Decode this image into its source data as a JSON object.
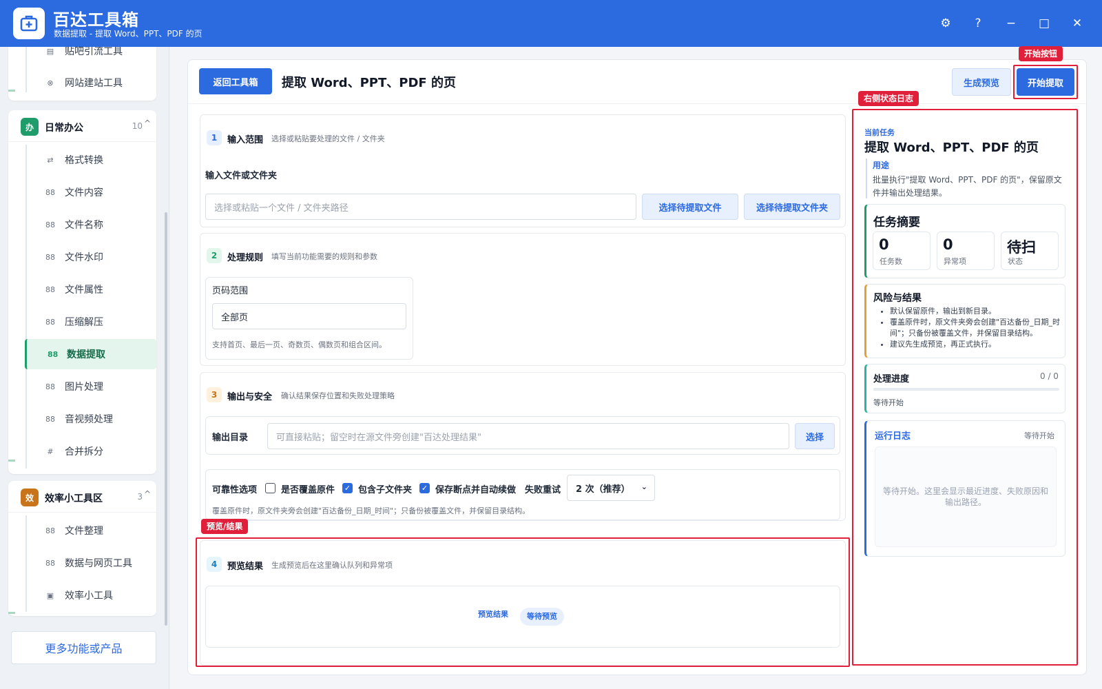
{
  "app": {
    "name": "百达工具箱",
    "subtitle": "数据提取 - 提取 Word、PPT、PDF 的页",
    "controls": {
      "settings": "⚙",
      "help": "?",
      "minimize": "−",
      "maximize": "□",
      "close": "✕"
    }
  },
  "sidebar": {
    "top_items": [
      {
        "icon": "list-icon",
        "label": "贴吧引流工具"
      },
      {
        "icon": "globe-icon",
        "label": "网站建站工具"
      }
    ],
    "groups": [
      {
        "badge": "办",
        "badge_color": "#1e9c6a",
        "title": "日常办公",
        "count": "10",
        "caret": "^",
        "items": [
          {
            "icon": "⇄",
            "label": "格式转换"
          },
          {
            "icon": "88",
            "label": "文件内容"
          },
          {
            "icon": "88",
            "label": "文件名称"
          },
          {
            "icon": "88",
            "label": "文件水印"
          },
          {
            "icon": "88",
            "label": "文件属性"
          },
          {
            "icon": "88",
            "label": "压缩解压"
          },
          {
            "icon": "88",
            "label": "数据提取",
            "active": true
          },
          {
            "icon": "88",
            "label": "图片处理"
          },
          {
            "icon": "88",
            "label": "音视频处理"
          },
          {
            "icon": "#",
            "label": "合并拆分"
          }
        ]
      },
      {
        "badge": "效",
        "badge_color": "#c8741a",
        "title": "效率小工具区",
        "count": "3",
        "caret": "^",
        "items": [
          {
            "icon": "88",
            "label": "文件整理"
          },
          {
            "icon": "88",
            "label": "数据与网页工具"
          },
          {
            "icon": "▣",
            "label": "效率小工具"
          }
        ]
      }
    ],
    "more": "更多功能或产品"
  },
  "header": {
    "back": "返回工具箱",
    "title": "提取 Word、PPT、PDF 的页",
    "preview_btn": "生成预览",
    "start_btn": "开始提取"
  },
  "annotations": {
    "start": "开始按钮",
    "log": "右侧状态日志",
    "preview": "预览/结果"
  },
  "sections": {
    "input": {
      "step": "1",
      "title": "输入范围",
      "desc": "选择或粘贴要处理的文件 / 文件夹",
      "field_label": "输入文件或文件夹",
      "placeholder": "选择或粘贴一个文件 / 文件夹路径",
      "btn_file": "选择待提取文件",
      "btn_folder": "选择待提取文件夹"
    },
    "rules": {
      "step": "2",
      "title": "处理规则",
      "desc": "填写当前功能需要的规则和参数",
      "page_range_label": "页码范围",
      "page_range_value": "全部页",
      "page_range_hint": "支持首页、最后一页、奇数页、偶数页和组合区间。"
    },
    "output": {
      "step": "3",
      "title": "输出与安全",
      "desc": "确认结果保存位置和失败处理策略",
      "dir_label": "输出目录",
      "dir_placeholder": "可直接粘贴；留空时在源文件旁创建\"百达处理结果\"",
      "dir_btn": "选择",
      "reliability_label": "可靠性选项",
      "opt_overwrite": "是否覆盖原件",
      "opt_subfolders": "包含子文件夹",
      "opt_resume": "保存断点并自动续做",
      "retry_label": "失败重试",
      "retry_value": "2 次（推荐）",
      "note": "覆盖原件时，原文件夹旁会创建\"百达备份_日期_时间\"；只备份被覆盖文件，并保留目录结构。"
    },
    "preview": {
      "step": "4",
      "title": "预览结果",
      "desc": "生成预览后在这里确认队列和异常项",
      "result_label": "预览结果",
      "result_status": "等待预览"
    }
  },
  "right_panel": {
    "current_task_label": "当前任务",
    "task_title": "提取 Word、PPT、PDF 的页",
    "purpose_label": "用途",
    "purpose_text": "批量执行\"提取 Word、PPT、PDF 的页\"，保留原文件并输出处理结果。",
    "summary_title": "任务摘要",
    "stats": [
      {
        "value": "0",
        "label": "任务数"
      },
      {
        "value": "0",
        "label": "异常项"
      },
      {
        "value": "待扫",
        "label": "状态"
      }
    ],
    "risk_title": "风险与结果",
    "risk_items": [
      "默认保留原件，输出到新目录。",
      "覆盖原件时，原文件夹旁会创建\"百达备份_日期_时间\"；只备份被覆盖文件，并保留目录结构。",
      "建议先生成预览，再正式执行。"
    ],
    "progress_title": "处理进度",
    "progress_count": "0 / 0",
    "progress_value": 0,
    "progress_status": "等待开始",
    "log_title": "运行日志",
    "log_status": "等待开始",
    "log_placeholder": "等待开始。这里会显示最近进度、失败原因和输出路径。"
  }
}
